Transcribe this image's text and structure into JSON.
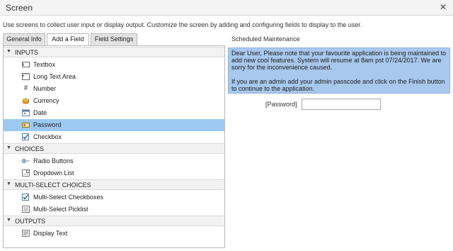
{
  "window": {
    "title": "Screen",
    "close_glyph": "✕"
  },
  "description": "Use screens to collect user input or display output. Customize the screen by adding and configuring fields to display to the user.",
  "tabs": [
    {
      "label": "General Info",
      "active": false
    },
    {
      "label": "Add a Field",
      "active": true
    },
    {
      "label": "Field Settings",
      "active": false
    }
  ],
  "palette": {
    "sections": [
      {
        "label": "INPUTS",
        "items": [
          {
            "label": "Textbox",
            "icon": "textbox-icon"
          },
          {
            "label": "Long Text Area",
            "icon": "long-text-area-icon"
          },
          {
            "label": "Number",
            "icon": "number-icon"
          },
          {
            "label": "Currency",
            "icon": "currency-icon"
          },
          {
            "label": "Date",
            "icon": "date-icon"
          },
          {
            "label": "Password",
            "icon": "password-icon",
            "selected": true
          },
          {
            "label": "Checkbox",
            "icon": "checkbox-icon"
          }
        ]
      },
      {
        "label": "CHOICES",
        "items": [
          {
            "label": "Radio Buttons",
            "icon": "radio-buttons-icon"
          },
          {
            "label": "Dropdown List",
            "icon": "dropdown-list-icon"
          }
        ]
      },
      {
        "label": "MULTI-SELECT CHOICES",
        "items": [
          {
            "label": "Multi-Select Checkboxes",
            "icon": "multi-select-checkboxes-icon"
          },
          {
            "label": "Multi-Select Picklist",
            "icon": "multi-select-picklist-icon"
          }
        ]
      },
      {
        "label": "OUTPUTS",
        "items": [
          {
            "label": "Display Text",
            "icon": "display-text-icon"
          }
        ]
      }
    ]
  },
  "preview": {
    "title": "Scheduled Maintenance",
    "message_p1": "Dear User, Please note that your favourite application is being maintained to add new cool features. System will resume at 8am pst 07/24/2017. We are sorry for the inconvenience caused.",
    "message_p2": "If you are an admin add your admin passcode and click on the Finish button to continue to the application.",
    "password_label": "[Password]",
    "password_value": ""
  },
  "colors": {
    "selected_row": "#9cc9f2",
    "message_bg": "#a8c8ee"
  }
}
